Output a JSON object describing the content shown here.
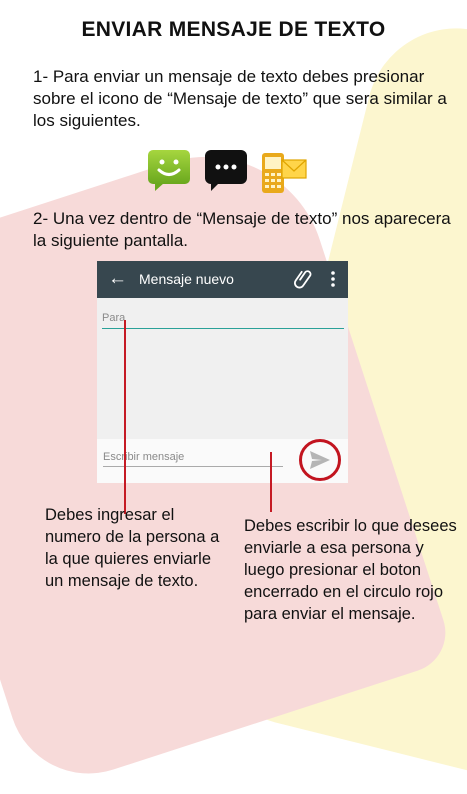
{
  "title": "ENVIAR MENSAJE DE TEXTO",
  "step1": "1- Para enviar un mensaje de texto debes presionar sobre el icono de “Mensaje de texto” que sera similar a los siguientes.",
  "step2": "2- Una vez dentro de “Mensaje de texto” nos aparecera la siguiente pantalla.",
  "app_icons": [
    "green-sms-app-icon",
    "black-chat-bubble-icon",
    "yellow-phone-message-icon"
  ],
  "phone": {
    "toolbar_title": "Mensaje nuevo",
    "to_placeholder": "Para",
    "message_placeholder": "Escribir mensaje",
    "icons": [
      "back-arrow-icon",
      "paperclip-icon",
      "more-vert-icon",
      "send-icon"
    ]
  },
  "notes": {
    "left": "Debes ingresar el numero de la persona a la que quieres enviarle un mensaje de texto.",
    "right": "Debes escribir lo que desees enviarle a esa persona y luego presionar el boton encerrado en el circulo rojo para enviar el mensaje."
  },
  "colors": {
    "toolbar": "#37474f",
    "accent_underline": "#2aa198",
    "highlight_red": "#c2141f",
    "bg_pink": "#f7dad9",
    "bg_yellow": "#fcf6cf"
  }
}
